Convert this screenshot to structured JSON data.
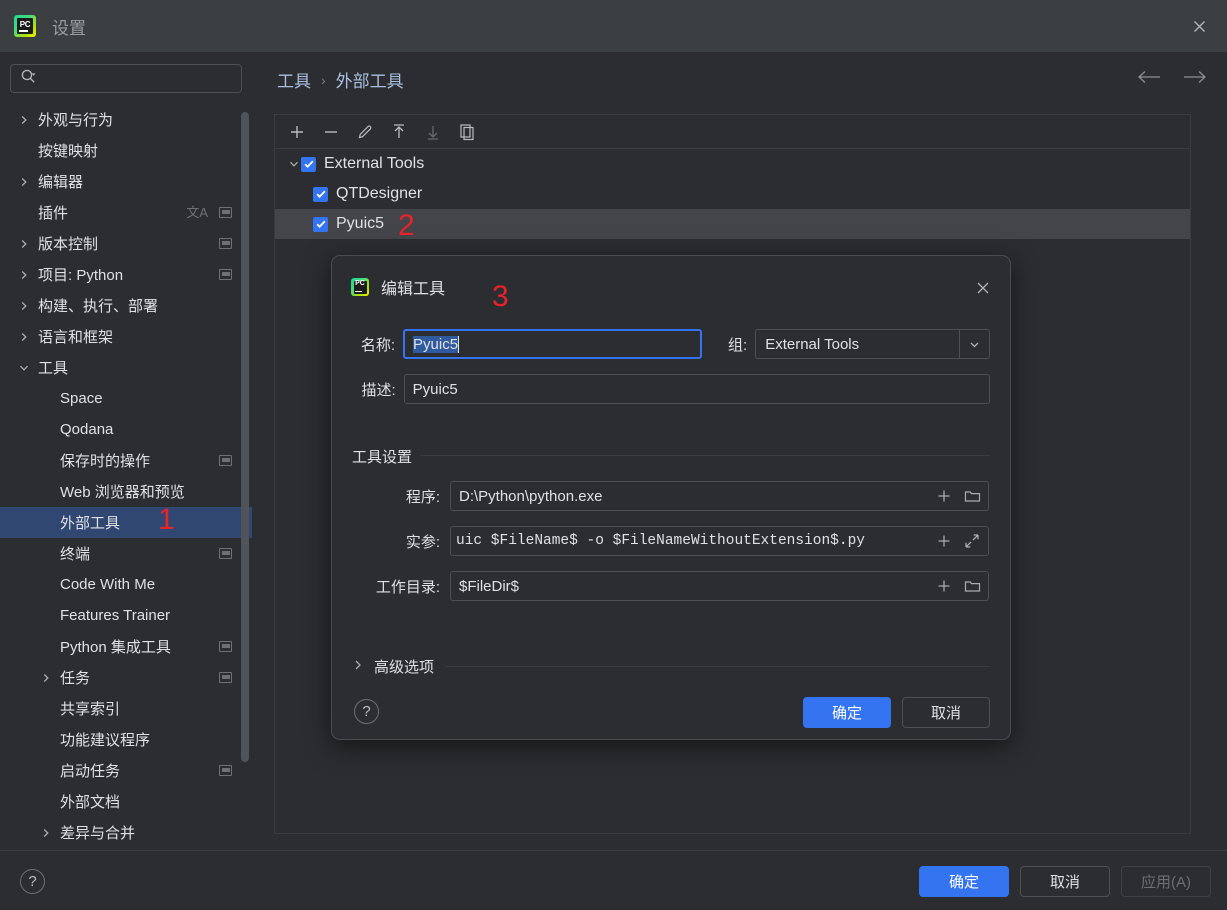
{
  "window": {
    "title": "设置",
    "app_icon": "pycharm-icon",
    "close_icon": "close-icon"
  },
  "search": {
    "value": "",
    "placeholder": "",
    "icon": "search-icon"
  },
  "sidebar": {
    "items": [
      {
        "label": "外观与行为",
        "level": 1,
        "expandable": true,
        "expanded": false,
        "badges": []
      },
      {
        "label": "按键映射",
        "level": 1,
        "expandable": false,
        "expanded": false,
        "badges": []
      },
      {
        "label": "编辑器",
        "level": 1,
        "expandable": true,
        "expanded": false,
        "badges": []
      },
      {
        "label": "插件",
        "level": 1,
        "expandable": false,
        "expanded": false,
        "badges": [
          "translate-icon",
          "window-badge-icon"
        ]
      },
      {
        "label": "版本控制",
        "level": 1,
        "expandable": true,
        "expanded": false,
        "badges": [
          "window-badge-icon"
        ]
      },
      {
        "label": "项目: Python",
        "level": 1,
        "expandable": true,
        "expanded": false,
        "badges": [
          "window-badge-icon"
        ]
      },
      {
        "label": "构建、执行、部署",
        "level": 1,
        "expandable": true,
        "expanded": false,
        "badges": []
      },
      {
        "label": "语言和框架",
        "level": 1,
        "expandable": true,
        "expanded": false,
        "badges": []
      },
      {
        "label": "工具",
        "level": 1,
        "expandable": true,
        "expanded": true,
        "badges": []
      },
      {
        "label": "Space",
        "level": 2,
        "expandable": false,
        "expanded": false,
        "badges": []
      },
      {
        "label": "Qodana",
        "level": 2,
        "expandable": false,
        "expanded": false,
        "badges": []
      },
      {
        "label": "保存时的操作",
        "level": 2,
        "expandable": false,
        "expanded": false,
        "badges": [
          "window-badge-icon"
        ]
      },
      {
        "label": "Web 浏览器和预览",
        "level": 2,
        "expandable": false,
        "expanded": false,
        "badges": []
      },
      {
        "label": "外部工具",
        "level": 2,
        "expandable": false,
        "expanded": false,
        "selected": true,
        "badges": []
      },
      {
        "label": "终端",
        "level": 2,
        "expandable": false,
        "expanded": false,
        "badges": [
          "window-badge-icon"
        ]
      },
      {
        "label": "Code With Me",
        "level": 2,
        "expandable": false,
        "expanded": false,
        "badges": []
      },
      {
        "label": "Features Trainer",
        "level": 2,
        "expandable": false,
        "expanded": false,
        "badges": []
      },
      {
        "label": "Python 集成工具",
        "level": 2,
        "expandable": false,
        "expanded": false,
        "badges": [
          "window-badge-icon"
        ]
      },
      {
        "label": "任务",
        "level": 2,
        "expandable": true,
        "expanded": false,
        "badges": [
          "window-badge-icon"
        ]
      },
      {
        "label": "共享索引",
        "level": 2,
        "expandable": false,
        "expanded": false,
        "badges": []
      },
      {
        "label": "功能建议程序",
        "level": 2,
        "expandable": false,
        "expanded": false,
        "badges": []
      },
      {
        "label": "启动任务",
        "level": 2,
        "expandable": false,
        "expanded": false,
        "badges": [
          "window-badge-icon"
        ]
      },
      {
        "label": "外部文档",
        "level": 2,
        "expandable": false,
        "expanded": false,
        "badges": []
      },
      {
        "label": "差异与合并",
        "level": 2,
        "expandable": true,
        "expanded": false,
        "badges": []
      }
    ]
  },
  "breadcrumb": {
    "parent": "工具",
    "separator": "›",
    "current": "外部工具"
  },
  "nav": {
    "back_icon": "arrow-left-icon",
    "forward_icon": "arrow-right-icon"
  },
  "toolbar": {
    "buttons": [
      {
        "name": "add-button",
        "icon": "plus-icon",
        "enabled": true
      },
      {
        "name": "remove-button",
        "icon": "minus-icon",
        "enabled": true
      },
      {
        "name": "edit-button",
        "icon": "pencil-icon",
        "enabled": true
      },
      {
        "name": "move-up-button",
        "icon": "arrow-up-icon",
        "enabled": true
      },
      {
        "name": "move-down-button",
        "icon": "arrow-down-icon",
        "enabled": false
      },
      {
        "name": "copy-button",
        "icon": "copy-icon",
        "enabled": true
      }
    ]
  },
  "tools_tree": {
    "rows": [
      {
        "label": "External Tools",
        "level": 0,
        "checked": true,
        "expanded": true,
        "selected": false,
        "annotation": ""
      },
      {
        "label": "QTDesigner",
        "level": 1,
        "checked": true,
        "expanded": false,
        "selected": false,
        "annotation": ""
      },
      {
        "label": "Pyuic5",
        "level": 1,
        "checked": true,
        "expanded": false,
        "selected": true,
        "annotation": "2"
      }
    ]
  },
  "annotations": {
    "one": "1",
    "two": "2",
    "three": "3",
    "color": "#e8232a"
  },
  "dialog": {
    "title": "编辑工具",
    "icon": "pycharm-icon",
    "close_icon": "close-icon",
    "name_label": "名称:",
    "name_value": "Pyuic5",
    "group_label": "组:",
    "group_value": "External Tools",
    "group_arrow_icon": "chevron-down-icon",
    "description_label": "描述:",
    "description_value": "Pyuic5",
    "tool_settings_title": "工具设置",
    "program_label": "程序:",
    "program_value": "D:\\Python\\python.exe",
    "arguments_label": "实参:",
    "arguments_value": "uic $FileName$ -o $FileNameWithoutExtension$.py",
    "working_dir_label": "工作目录:",
    "working_dir_value": "$FileDir$",
    "insert_macro_icon": "plus-icon",
    "browse_icon": "folder-icon",
    "expand_icon": "expand-arrows-icon",
    "advanced_label": "高级选项",
    "advanced_expanded": false,
    "help_icon": "question-mark-icon",
    "ok_label": "确定",
    "cancel_label": "取消"
  },
  "footer": {
    "help_icon": "question-mark-icon",
    "ok_label": "确定",
    "cancel_label": "取消",
    "apply_label": "应用(A)",
    "apply_enabled": false
  },
  "colors": {
    "accent": "#3574f0",
    "selection": "#2f4771",
    "background": "#2b2d30",
    "titlebar": "#3c3f41",
    "annotation_red": "#e8232a",
    "breadcrumb_link": "#a8c0e0"
  }
}
